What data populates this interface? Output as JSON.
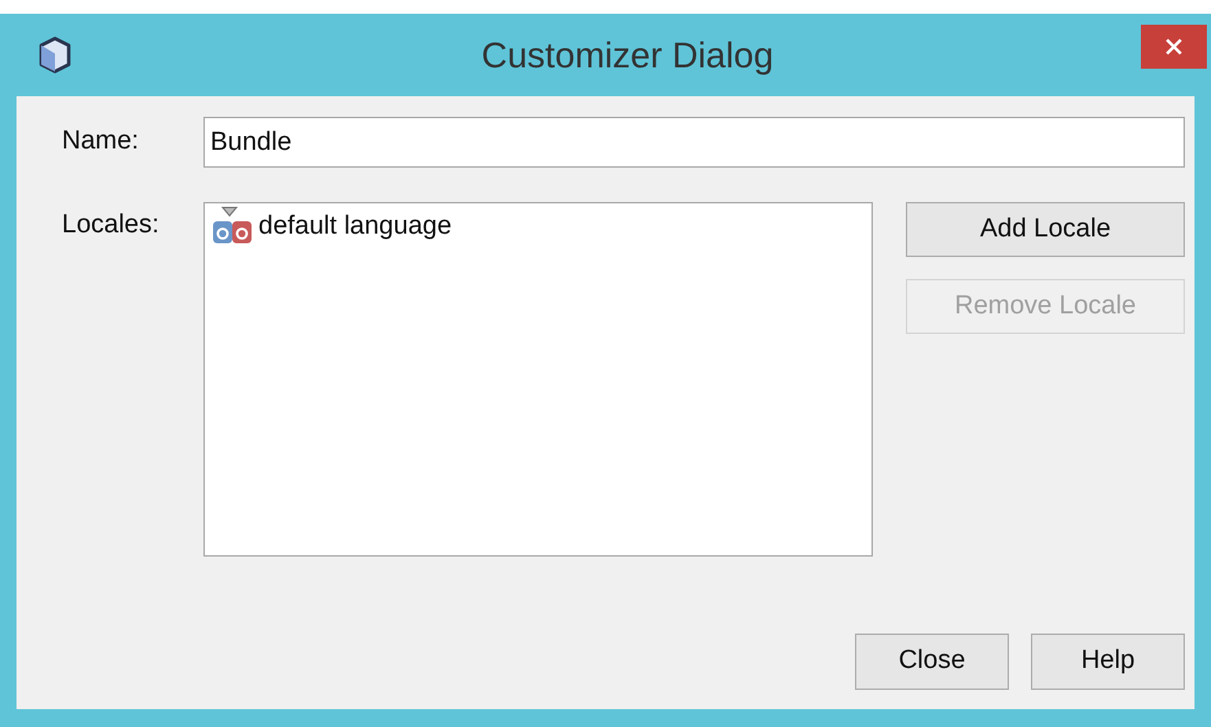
{
  "window": {
    "title": "Customizer Dialog"
  },
  "name_field": {
    "label": "Name:",
    "value": "Bundle"
  },
  "locales": {
    "label": "Locales:",
    "items": [
      {
        "text": "default language",
        "selected": false
      }
    ]
  },
  "side_buttons": [
    {
      "label": "Add Locale",
      "disabled": false
    },
    {
      "label": "Remove Locale",
      "disabled": true
    }
  ],
  "buttons": [
    "Close",
    "Help"
  ]
}
